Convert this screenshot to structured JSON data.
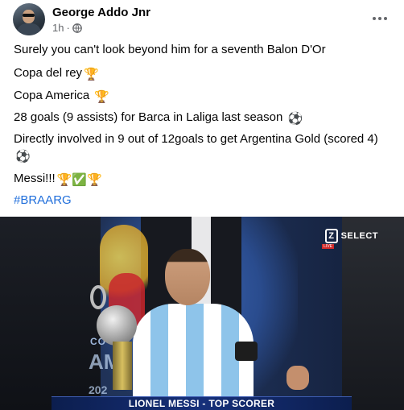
{
  "post": {
    "author": "George Addo Jnr",
    "time": "1h",
    "privacy_icon": "globe-icon",
    "more_icon": "more-options-icon",
    "lines": [
      {
        "text": "Surely you can't look beyond him for a seventh Balon D'Or",
        "emoji": ""
      },
      {
        "text": "Copa del rey",
        "emoji": "🏆"
      },
      {
        "text": "Copa America ",
        "emoji": "🏆"
      },
      {
        "text": "28 goals (9 assists) for Barca in Laliga last season ",
        "emoji": "⚽"
      },
      {
        "text": " Directly involved in  9 out of 12goals to get Argentina Gold (scored 4) ",
        "emoji": "⚽"
      },
      {
        "text": "Messi!!!",
        "emoji": "🏆✅🏆"
      }
    ],
    "hashtag": "#BRAARG"
  },
  "photo": {
    "broadcaster_label": "SELECT",
    "broadcaster_mark": "Z",
    "broadcaster_live": "LIVE",
    "background_text_small": "CO",
    "background_text_large": "AM",
    "background_year": "202",
    "caption": "LIONEL MESSI - TOP SCORER"
  },
  "colors": {
    "text": "#050505",
    "meta": "#65676b",
    "hashtag": "#216fdb",
    "caption_bar": "#16307a"
  }
}
